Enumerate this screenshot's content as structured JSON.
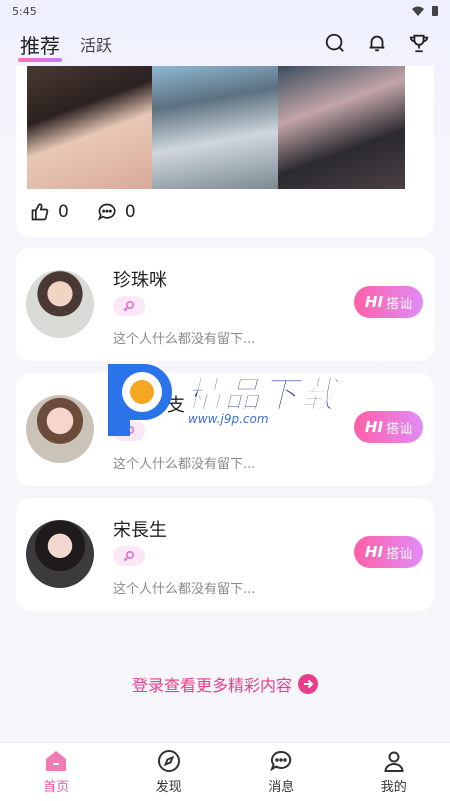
{
  "status_bar": {
    "time": "5:45"
  },
  "top_tabs": {
    "recommend": "推荐",
    "active": "活跃"
  },
  "post": {
    "like_count": "0",
    "comment_count": "0"
  },
  "users": [
    {
      "name": "珍珠咪",
      "bio": "这个人什么都没有留下...",
      "hi_mark": "HI",
      "hi_label": "搭讪"
    },
    {
      "name": "拥有…支",
      "bio": "这个人什么都没有留下...",
      "hi_mark": "HI",
      "hi_label": "搭讪"
    },
    {
      "name": "宋長生",
      "bio": "这个人什么都没有留下...",
      "hi_mark": "HI",
      "hi_label": "搭讪"
    }
  ],
  "watermark": {
    "title": "精品下载",
    "url": "www.j9p.com"
  },
  "login_more": "登录查看更多精彩内容",
  "bottom_nav": {
    "home": "首页",
    "discover": "发现",
    "messages": "消息",
    "mine": "我的"
  },
  "colors": {
    "accent": "#f15aa0",
    "hi_gradient_start": "#ff5fa7",
    "hi_gradient_end": "#e08cf7"
  }
}
